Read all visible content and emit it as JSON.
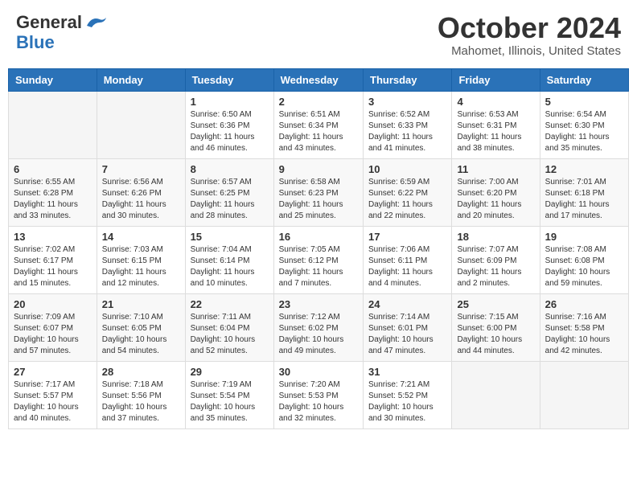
{
  "header": {
    "logo_general": "General",
    "logo_blue": "Blue",
    "month": "October 2024",
    "location": "Mahomet, Illinois, United States"
  },
  "weekdays": [
    "Sunday",
    "Monday",
    "Tuesday",
    "Wednesday",
    "Thursday",
    "Friday",
    "Saturday"
  ],
  "weeks": [
    [
      {
        "day": "",
        "info": ""
      },
      {
        "day": "",
        "info": ""
      },
      {
        "day": "1",
        "info": "Sunrise: 6:50 AM\nSunset: 6:36 PM\nDaylight: 11 hours and 46 minutes."
      },
      {
        "day": "2",
        "info": "Sunrise: 6:51 AM\nSunset: 6:34 PM\nDaylight: 11 hours and 43 minutes."
      },
      {
        "day": "3",
        "info": "Sunrise: 6:52 AM\nSunset: 6:33 PM\nDaylight: 11 hours and 41 minutes."
      },
      {
        "day": "4",
        "info": "Sunrise: 6:53 AM\nSunset: 6:31 PM\nDaylight: 11 hours and 38 minutes."
      },
      {
        "day": "5",
        "info": "Sunrise: 6:54 AM\nSunset: 6:30 PM\nDaylight: 11 hours and 35 minutes."
      }
    ],
    [
      {
        "day": "6",
        "info": "Sunrise: 6:55 AM\nSunset: 6:28 PM\nDaylight: 11 hours and 33 minutes."
      },
      {
        "day": "7",
        "info": "Sunrise: 6:56 AM\nSunset: 6:26 PM\nDaylight: 11 hours and 30 minutes."
      },
      {
        "day": "8",
        "info": "Sunrise: 6:57 AM\nSunset: 6:25 PM\nDaylight: 11 hours and 28 minutes."
      },
      {
        "day": "9",
        "info": "Sunrise: 6:58 AM\nSunset: 6:23 PM\nDaylight: 11 hours and 25 minutes."
      },
      {
        "day": "10",
        "info": "Sunrise: 6:59 AM\nSunset: 6:22 PM\nDaylight: 11 hours and 22 minutes."
      },
      {
        "day": "11",
        "info": "Sunrise: 7:00 AM\nSunset: 6:20 PM\nDaylight: 11 hours and 20 minutes."
      },
      {
        "day": "12",
        "info": "Sunrise: 7:01 AM\nSunset: 6:18 PM\nDaylight: 11 hours and 17 minutes."
      }
    ],
    [
      {
        "day": "13",
        "info": "Sunrise: 7:02 AM\nSunset: 6:17 PM\nDaylight: 11 hours and 15 minutes."
      },
      {
        "day": "14",
        "info": "Sunrise: 7:03 AM\nSunset: 6:15 PM\nDaylight: 11 hours and 12 minutes."
      },
      {
        "day": "15",
        "info": "Sunrise: 7:04 AM\nSunset: 6:14 PM\nDaylight: 11 hours and 10 minutes."
      },
      {
        "day": "16",
        "info": "Sunrise: 7:05 AM\nSunset: 6:12 PM\nDaylight: 11 hours and 7 minutes."
      },
      {
        "day": "17",
        "info": "Sunrise: 7:06 AM\nSunset: 6:11 PM\nDaylight: 11 hours and 4 minutes."
      },
      {
        "day": "18",
        "info": "Sunrise: 7:07 AM\nSunset: 6:09 PM\nDaylight: 11 hours and 2 minutes."
      },
      {
        "day": "19",
        "info": "Sunrise: 7:08 AM\nSunset: 6:08 PM\nDaylight: 10 hours and 59 minutes."
      }
    ],
    [
      {
        "day": "20",
        "info": "Sunrise: 7:09 AM\nSunset: 6:07 PM\nDaylight: 10 hours and 57 minutes."
      },
      {
        "day": "21",
        "info": "Sunrise: 7:10 AM\nSunset: 6:05 PM\nDaylight: 10 hours and 54 minutes."
      },
      {
        "day": "22",
        "info": "Sunrise: 7:11 AM\nSunset: 6:04 PM\nDaylight: 10 hours and 52 minutes."
      },
      {
        "day": "23",
        "info": "Sunrise: 7:12 AM\nSunset: 6:02 PM\nDaylight: 10 hours and 49 minutes."
      },
      {
        "day": "24",
        "info": "Sunrise: 7:14 AM\nSunset: 6:01 PM\nDaylight: 10 hours and 47 minutes."
      },
      {
        "day": "25",
        "info": "Sunrise: 7:15 AM\nSunset: 6:00 PM\nDaylight: 10 hours and 44 minutes."
      },
      {
        "day": "26",
        "info": "Sunrise: 7:16 AM\nSunset: 5:58 PM\nDaylight: 10 hours and 42 minutes."
      }
    ],
    [
      {
        "day": "27",
        "info": "Sunrise: 7:17 AM\nSunset: 5:57 PM\nDaylight: 10 hours and 40 minutes."
      },
      {
        "day": "28",
        "info": "Sunrise: 7:18 AM\nSunset: 5:56 PM\nDaylight: 10 hours and 37 minutes."
      },
      {
        "day": "29",
        "info": "Sunrise: 7:19 AM\nSunset: 5:54 PM\nDaylight: 10 hours and 35 minutes."
      },
      {
        "day": "30",
        "info": "Sunrise: 7:20 AM\nSunset: 5:53 PM\nDaylight: 10 hours and 32 minutes."
      },
      {
        "day": "31",
        "info": "Sunrise: 7:21 AM\nSunset: 5:52 PM\nDaylight: 10 hours and 30 minutes."
      },
      {
        "day": "",
        "info": ""
      },
      {
        "day": "",
        "info": ""
      }
    ]
  ]
}
